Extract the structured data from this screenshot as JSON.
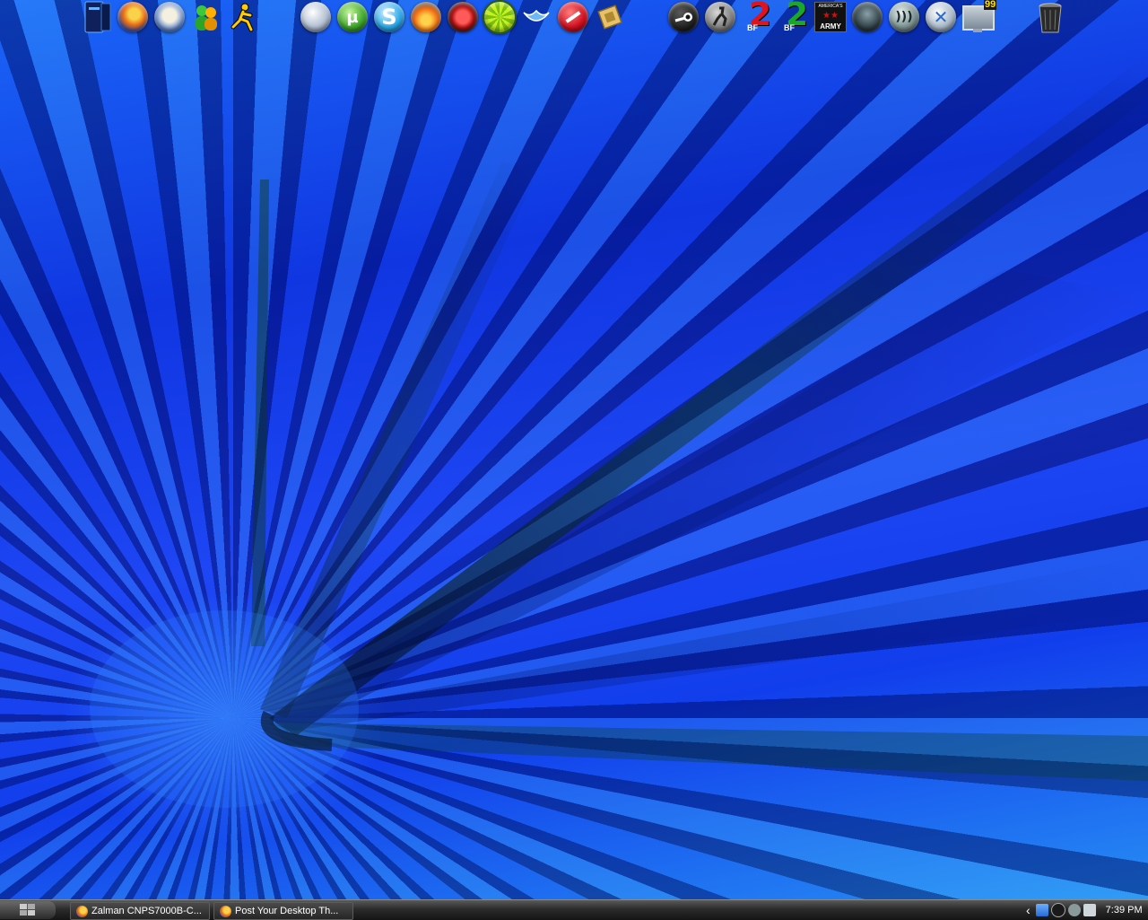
{
  "desktop": {
    "dock_left": [
      {
        "name": "my-computer",
        "icon": "computer-icon"
      },
      {
        "name": "firefox",
        "icon": "firefox-icon"
      },
      {
        "name": "thunderbird",
        "icon": "thunderbird-icon"
      },
      {
        "name": "msn-messenger",
        "icon": "messenger-icon"
      },
      {
        "name": "aim",
        "icon": "aim-running-man-icon"
      }
    ],
    "dock_middle": [
      {
        "name": "app-feather",
        "icon": "feather-icon"
      },
      {
        "name": "utorrent",
        "icon": "utorrent-icon",
        "glyph": "µ"
      },
      {
        "name": "skype",
        "icon": "skype-icon",
        "glyph": "S"
      },
      {
        "name": "orange-orb",
        "icon": "fire-orb-icon"
      },
      {
        "name": "red-circle-app",
        "icon": "red-slash-icon"
      },
      {
        "name": "limewire",
        "icon": "limewire-icon"
      },
      {
        "name": "wings-app",
        "icon": "wings-icon"
      },
      {
        "name": "no-entry-app",
        "icon": "no-entry-icon"
      },
      {
        "name": "cpu-app",
        "icon": "cpu-chip-icon"
      }
    ],
    "dock_right": [
      {
        "name": "steam",
        "icon": "steam-icon"
      },
      {
        "name": "counter-strike",
        "icon": "counter-strike-icon"
      },
      {
        "name": "battlefield-2",
        "icon": "bf2-red-icon",
        "glyph": "2",
        "sub": "BF"
      },
      {
        "name": "battlefield-2-special",
        "icon": "bf2-green-icon",
        "glyph": "2",
        "sub": "BF"
      },
      {
        "name": "americas-army",
        "icon": "americas-army-icon",
        "glyph": "AMERICA'S",
        "sub": "ARMY"
      },
      {
        "name": "halo",
        "icon": "halo-icon"
      },
      {
        "name": "ventrilo",
        "icon": "ventrilo-icon"
      },
      {
        "name": "xfire",
        "icon": "xfire-icon"
      },
      {
        "name": "display-monitor",
        "icon": "monitor-icon",
        "glyph": "99"
      }
    ],
    "recycle_bin": {
      "icon": "recycle-bin-icon"
    }
  },
  "taskbar": {
    "tasks": [
      {
        "label": "Zalman CNPS7000B-C..."
      },
      {
        "label": "Post Your Desktop Th..."
      }
    ],
    "tray": {
      "expand_label": "‹",
      "clock": "7:39 PM"
    }
  },
  "colors": {
    "wallpaper_base": "#0b2ad8",
    "taskbar": "#1e1e1e"
  }
}
